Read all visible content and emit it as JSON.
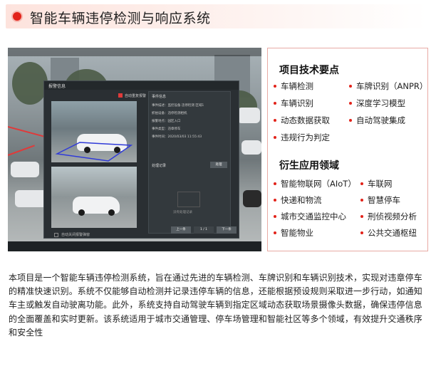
{
  "header": {
    "title": "智能车辆违停检测与响应系统",
    "accent_color": "#e2231a"
  },
  "screenshot": {
    "dialog": {
      "title": "报警信息",
      "recording_label": "自动重复报警",
      "autoclose_label": "自动关闭报警弹窗",
      "panel_title": "事件信息",
      "info_rows": [
        "事件描述：监控设备 违停检测 区域1",
        "抓拍设备：违停检测相机",
        "报警地点：园区入口",
        "事件类型：违章停车",
        "事件时间：2020/03/03 11:55:43"
      ],
      "records_title": "处理记录",
      "records_button": "处理",
      "empty_label": "没有处理记录",
      "buttons": [
        "上一条",
        "1 / 1",
        "下一条"
      ]
    }
  },
  "features": {
    "tech_title": "项目技术要点",
    "tech_items": [
      "车辆检测",
      "车牌识别（ANPR）",
      "车辆识别",
      "深度学习模型",
      "动态数据获取",
      "自动驾驶集成",
      "违规行为判定"
    ],
    "app_title": "衍生应用领域",
    "app_items": [
      "智能物联网（AIoT）",
      "车联网",
      "快递和物流",
      "智慧停车",
      "城市交通监控中心",
      "刑侦视频分析",
      "智能物业",
      "公共交通枢纽"
    ]
  },
  "description": "本项目是一个智能车辆违停检测系统，旨在通过先进的车辆检测、车牌识别和车辆识别技术，实现对违章停车的精准快速识别。系统不仅能够自动检测并记录违停车辆的信息，还能根据预设规则采取进一步行动，如通知车主或触发自动驶离功能。此外，系统支持自动驾驶车辆到指定区域动态获取场景摄像头数据，确保违停信息的全面覆盖和实时更新。该系统适用于城市交通管理、停车场管理和智能社区等多个领域，有效提升交通秩序和安全性"
}
